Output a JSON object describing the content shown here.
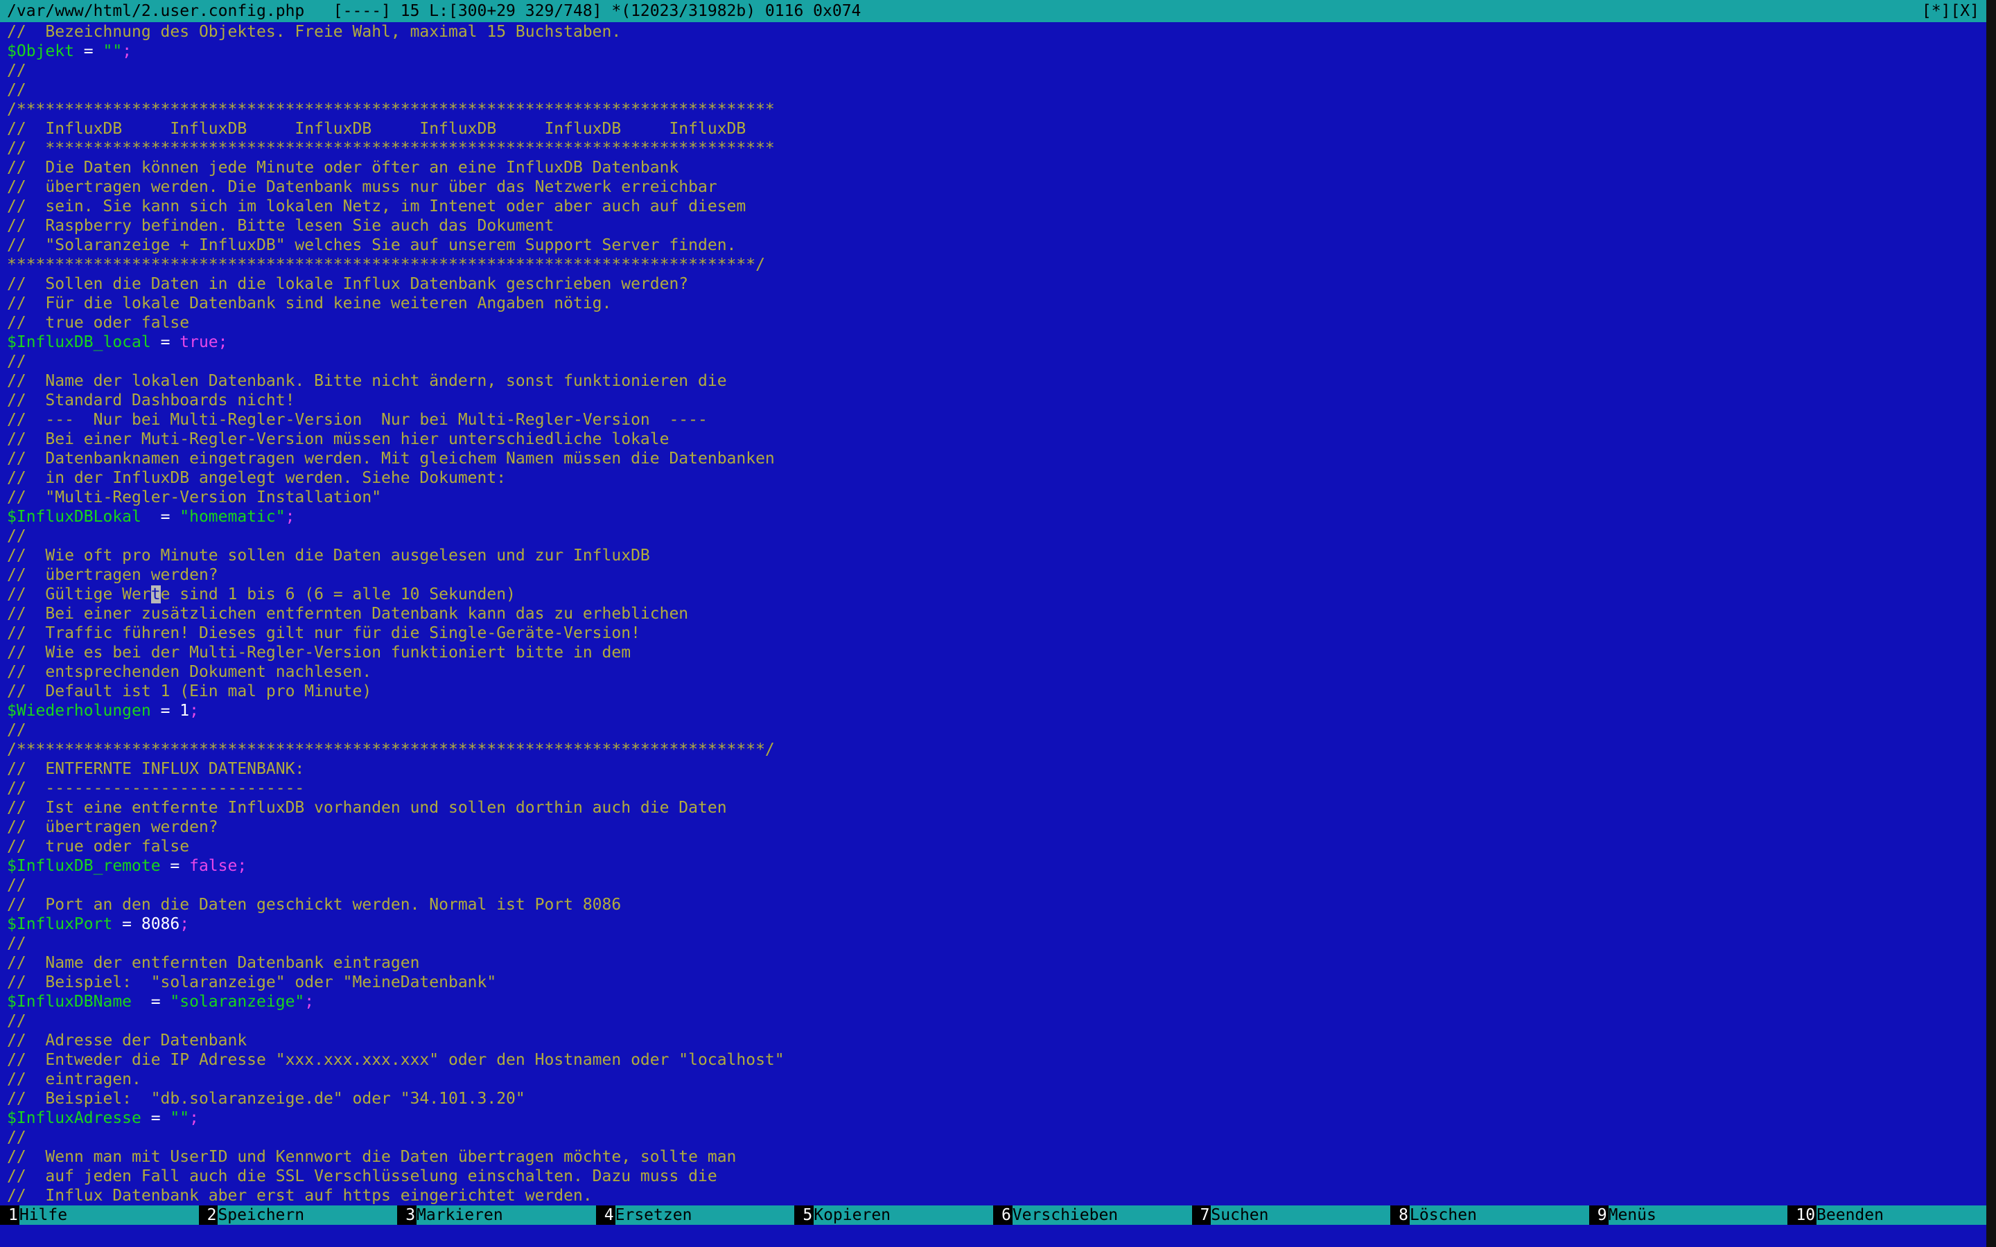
{
  "titlebar": {
    "left_text": "/var/www/html/2.user.config.php   [----] 15 L:[300+29 329/748] *(12023/31982b) 0116 0x074",
    "right_text": "[*][X]"
  },
  "colors": {
    "background": "#1010b8",
    "titlebar": "#19a3a3",
    "comment": "#b2ac3c",
    "variable": "#1ad41a",
    "keyword": "#e848e8",
    "operator": "#ffffff"
  },
  "editor": {
    "lines": [
      [
        {
          "t": "//  Bezeichnung des Objektes. Freie Wahl, maximal 15 Buchstaben.",
          "c": "comment"
        }
      ],
      [
        {
          "t": "$Objekt",
          "c": "var"
        },
        {
          "t": " = ",
          "c": "op"
        },
        {
          "t": "\"\"",
          "c": "string"
        },
        {
          "t": ";",
          "c": "semi"
        }
      ],
      [
        {
          "t": "//",
          "c": "comment"
        }
      ],
      [
        {
          "t": "//",
          "c": "comment"
        }
      ],
      [
        {
          "t": "/*******************************************************************************",
          "c": "comment"
        }
      ],
      [
        {
          "t": "//  InfluxDB     InfluxDB     InfluxDB     InfluxDB     InfluxDB     InfluxDB",
          "c": "comment"
        }
      ],
      [
        {
          "t": "//  ****************************************************************************",
          "c": "comment"
        }
      ],
      [
        {
          "t": "//  Die Daten können jede Minute oder öfter an eine InfluxDB Datenbank",
          "c": "comment"
        }
      ],
      [
        {
          "t": "//  übertragen werden. Die Datenbank muss nur über das Netzwerk erreichbar",
          "c": "comment"
        }
      ],
      [
        {
          "t": "//  sein. Sie kann sich im lokalen Netz, im Intenet oder aber auch auf diesem",
          "c": "comment"
        }
      ],
      [
        {
          "t": "//  Raspberry befinden. Bitte lesen Sie auch das Dokument",
          "c": "comment"
        }
      ],
      [
        {
          "t": "//  \"Solaranzeige + InfluxDB\" welches Sie auf unserem Support Server finden.",
          "c": "comment"
        }
      ],
      [
        {
          "t": "******************************************************************************/",
          "c": "comment"
        }
      ],
      [
        {
          "t": "//  Sollen die Daten in die lokale Influx Datenbank geschrieben werden?",
          "c": "comment"
        }
      ],
      [
        {
          "t": "//  Für die lokale Datenbank sind keine weiteren Angaben nötig.",
          "c": "comment"
        }
      ],
      [
        {
          "t": "//  true oder false",
          "c": "comment"
        }
      ],
      [
        {
          "t": "$InfluxDB_local",
          "c": "var"
        },
        {
          "t": " = ",
          "c": "op"
        },
        {
          "t": "true",
          "c": "bool"
        },
        {
          "t": ";",
          "c": "semi"
        }
      ],
      [
        {
          "t": "//",
          "c": "comment"
        }
      ],
      [
        {
          "t": "//  Name der lokalen Datenbank. Bitte nicht ändern, sonst funktionieren die",
          "c": "comment"
        }
      ],
      [
        {
          "t": "//  Standard Dashboards nicht!",
          "c": "comment"
        }
      ],
      [
        {
          "t": "//  ---  Nur bei Multi-Regler-Version  Nur bei Multi-Regler-Version  ----",
          "c": "comment"
        }
      ],
      [
        {
          "t": "//  Bei einer Muti-Regler-Version müssen hier unterschiedliche lokale",
          "c": "comment"
        }
      ],
      [
        {
          "t": "//  Datenbanknamen eingetragen werden. Mit gleichem Namen müssen die Datenbanken",
          "c": "comment"
        }
      ],
      [
        {
          "t": "//  in der InfluxDB angelegt werden. Siehe Dokument:",
          "c": "comment"
        }
      ],
      [
        {
          "t": "//  \"Multi-Regler-Version Installation\"",
          "c": "comment"
        }
      ],
      [
        {
          "t": "$InfluxDBLokal",
          "c": "var"
        },
        {
          "t": "  = ",
          "c": "op"
        },
        {
          "t": "\"homematic\"",
          "c": "string"
        },
        {
          "t": ";",
          "c": "semi"
        }
      ],
      [
        {
          "t": "//",
          "c": "comment"
        }
      ],
      [
        {
          "t": "//  Wie oft pro Minute sollen die Daten ausgelesen und zur InfluxDB",
          "c": "comment"
        }
      ],
      [
        {
          "t": "//  übertragen werden?",
          "c": "comment"
        }
      ],
      [
        {
          "t": "//  Gültige Wer",
          "c": "comment"
        },
        {
          "t": "t",
          "c": "cursor"
        },
        {
          "t": "e sind 1 bis 6 (6 = alle 10 Sekunden)",
          "c": "comment"
        }
      ],
      [
        {
          "t": "//  Bei einer zusätzlichen entfernten Datenbank kann das zu erheblichen",
          "c": "comment"
        }
      ],
      [
        {
          "t": "//  Traffic führen! Dieses gilt nur für die Single-Geräte-Version!",
          "c": "comment"
        }
      ],
      [
        {
          "t": "//  Wie es bei der Multi-Regler-Version funktioniert bitte in dem",
          "c": "comment"
        }
      ],
      [
        {
          "t": "//  entsprechenden Dokument nachlesen.",
          "c": "comment"
        }
      ],
      [
        {
          "t": "//  Default ist 1 (Ein mal pro Minute)",
          "c": "comment"
        }
      ],
      [
        {
          "t": "$Wiederholungen",
          "c": "var"
        },
        {
          "t": " = ",
          "c": "op"
        },
        {
          "t": "1",
          "c": "num"
        },
        {
          "t": ";",
          "c": "semi"
        }
      ],
      [
        {
          "t": "//",
          "c": "comment"
        }
      ],
      [
        {
          "t": "/******************************************************************************/",
          "c": "comment"
        }
      ],
      [
        {
          "t": "//  ENTFERNTE INFLUX DATENBANK:",
          "c": "comment"
        }
      ],
      [
        {
          "t": "//  ---------------------------",
          "c": "comment"
        }
      ],
      [
        {
          "t": "//  Ist eine entfernte InfluxDB vorhanden und sollen dorthin auch die Daten",
          "c": "comment"
        }
      ],
      [
        {
          "t": "//  übertragen werden?",
          "c": "comment"
        }
      ],
      [
        {
          "t": "//  true oder false",
          "c": "comment"
        }
      ],
      [
        {
          "t": "$InfluxDB_remote",
          "c": "var"
        },
        {
          "t": " = ",
          "c": "op"
        },
        {
          "t": "false",
          "c": "bool"
        },
        {
          "t": ";",
          "c": "semi"
        }
      ],
      [
        {
          "t": "//",
          "c": "comment"
        }
      ],
      [
        {
          "t": "//  Port an den die Daten geschickt werden. Normal ist Port 8086",
          "c": "comment"
        }
      ],
      [
        {
          "t": "$InfluxPort",
          "c": "var"
        },
        {
          "t": " = ",
          "c": "op"
        },
        {
          "t": "8086",
          "c": "num"
        },
        {
          "t": ";",
          "c": "semi"
        }
      ],
      [
        {
          "t": "//",
          "c": "comment"
        }
      ],
      [
        {
          "t": "//  Name der entfernten Datenbank eintragen",
          "c": "comment"
        }
      ],
      [
        {
          "t": "//  Beispiel:  \"solaranzeige\" oder \"MeineDatenbank\"",
          "c": "comment"
        }
      ],
      [
        {
          "t": "$InfluxDBName",
          "c": "var"
        },
        {
          "t": "  = ",
          "c": "op"
        },
        {
          "t": "\"solaranzeige\"",
          "c": "string"
        },
        {
          "t": ";",
          "c": "semi"
        }
      ],
      [
        {
          "t": "//",
          "c": "comment"
        }
      ],
      [
        {
          "t": "//  Adresse der Datenbank",
          "c": "comment"
        }
      ],
      [
        {
          "t": "//  Entweder die IP Adresse \"xxx.xxx.xxx.xxx\" oder den Hostnamen oder \"localhost\"",
          "c": "comment"
        }
      ],
      [
        {
          "t": "//  eintragen.",
          "c": "comment"
        }
      ],
      [
        {
          "t": "//  Beispiel:  \"db.solaranzeige.de\" oder \"34.101.3.20\"",
          "c": "comment"
        }
      ],
      [
        {
          "t": "$InfluxAdresse",
          "c": "var"
        },
        {
          "t": " = ",
          "c": "op"
        },
        {
          "t": "\"\"",
          "c": "string"
        },
        {
          "t": ";",
          "c": "semi"
        }
      ],
      [
        {
          "t": "//",
          "c": "comment"
        }
      ],
      [
        {
          "t": "//  Wenn man mit UserID und Kennwort die Daten übertragen möchte, sollte man",
          "c": "comment"
        }
      ],
      [
        {
          "t": "//  auf jeden Fall auch die SSL Verschlüsselung einschalten. Dazu muss die",
          "c": "comment"
        }
      ],
      [
        {
          "t": "//  Influx Datenbank aber erst auf https eingerichtet werden.",
          "c": "comment"
        }
      ]
    ]
  },
  "fkeys": [
    {
      "num": "1",
      "label": "Hilfe"
    },
    {
      "num": "2",
      "label": "Speichern"
    },
    {
      "num": "3",
      "label": "Markieren"
    },
    {
      "num": "4",
      "label": "Ersetzen"
    },
    {
      "num": "5",
      "label": "Kopieren"
    },
    {
      "num": "6",
      "label": "Verschieben"
    },
    {
      "num": "7",
      "label": "Suchen"
    },
    {
      "num": "8",
      "label": "Löschen"
    },
    {
      "num": "9",
      "label": "Menüs"
    },
    {
      "num": "10",
      "label": "Beenden"
    }
  ]
}
